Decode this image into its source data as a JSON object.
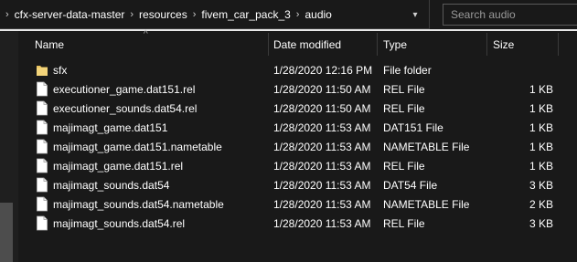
{
  "breadcrumb": {
    "items": [
      "cfx-server-data-master",
      "resources",
      "fivem_car_pack_3",
      "audio"
    ],
    "separator": "›"
  },
  "search": {
    "placeholder": "Search audio"
  },
  "columns": {
    "name": "Name",
    "date": "Date modified",
    "type": "Type",
    "size": "Size"
  },
  "files": [
    {
      "name": "sfx",
      "date": "1/28/2020 12:16 PM",
      "type": "File folder",
      "size": "",
      "icon": "folder-icon"
    },
    {
      "name": "executioner_game.dat151.rel",
      "date": "1/28/2020 11:50 AM",
      "type": "REL File",
      "size": "1 KB",
      "icon": "file-icon"
    },
    {
      "name": "executioner_sounds.dat54.rel",
      "date": "1/28/2020 11:50 AM",
      "type": "REL File",
      "size": "1 KB",
      "icon": "file-icon"
    },
    {
      "name": "majimagt_game.dat151",
      "date": "1/28/2020 11:53 AM",
      "type": "DAT151 File",
      "size": "1 KB",
      "icon": "file-icon"
    },
    {
      "name": "majimagt_game.dat151.nametable",
      "date": "1/28/2020 11:53 AM",
      "type": "NAMETABLE File",
      "size": "1 KB",
      "icon": "file-icon"
    },
    {
      "name": "majimagt_game.dat151.rel",
      "date": "1/28/2020 11:53 AM",
      "type": "REL File",
      "size": "1 KB",
      "icon": "file-icon"
    },
    {
      "name": "majimagt_sounds.dat54",
      "date": "1/28/2020 11:53 AM",
      "type": "DAT54 File",
      "size": "3 KB",
      "icon": "file-icon"
    },
    {
      "name": "majimagt_sounds.dat54.nametable",
      "date": "1/28/2020 11:53 AM",
      "type": "NAMETABLE File",
      "size": "2 KB",
      "icon": "file-icon"
    },
    {
      "name": "majimagt_sounds.dat54.rel",
      "date": "1/28/2020 11:53 AM",
      "type": "REL File",
      "size": "3 KB",
      "icon": "file-icon"
    }
  ],
  "colors": {
    "background": "#191919",
    "text": "#ffffff",
    "folder": "#e8c25e",
    "border": "#3c3c3c"
  }
}
